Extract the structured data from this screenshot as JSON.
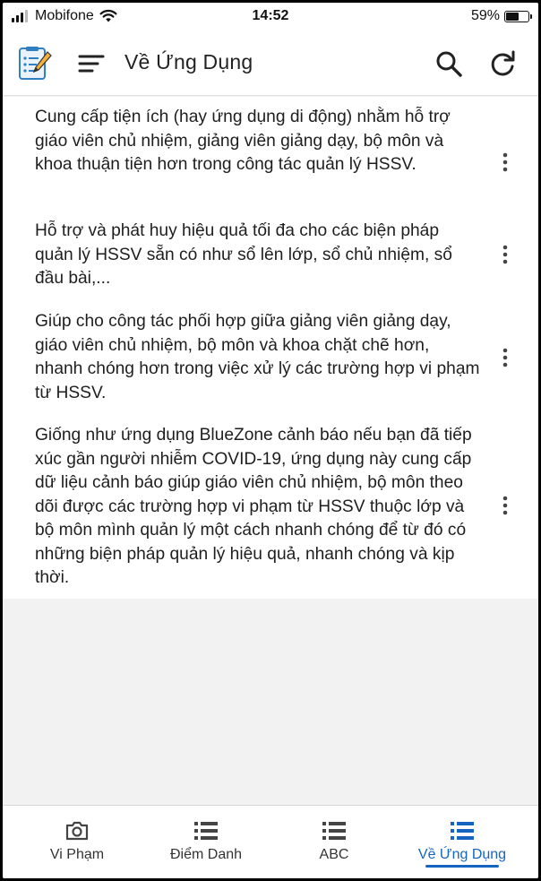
{
  "status_bar": {
    "carrier": "Mobifone",
    "time": "14:52",
    "battery": "59%",
    "battery_level": 0.59
  },
  "app_bar": {
    "title": "Về Ứng Dụng",
    "logo_icon": "checklist-pencil-icon",
    "menu_icon": "menu-icon",
    "search_icon": "search-icon",
    "refresh_icon": "refresh-icon"
  },
  "items": [
    {
      "text": "Cung cấp tiện ích (hay ứng dụng di động) nhằm hỗ trợ giáo viên chủ nhiệm, giảng viên giảng dạy, bộ môn và khoa thuận tiện hơn trong công tác quản lý HSSV."
    },
    {
      "text": "Hỗ trợ và phát huy hiệu quả tối đa cho các biện pháp quản lý HSSV sẵn có như sổ lên lớp, sổ chủ nhiệm, sổ đầu bài,..."
    },
    {
      "text": "Giúp cho công tác phối hợp giữa giảng viên giảng dạy, giáo viên chủ nhiệm, bộ môn và khoa chặt chẽ hơn, nhanh chóng hơn trong việc xử lý các trường hợp vi phạm từ HSSV."
    },
    {
      "text": "Giống như ứng dụng BlueZone cảnh báo nếu bạn đã tiếp xúc gần người nhiễm COVID-19, ứng dụng này cung cấp dữ liệu cảnh báo giúp giáo viên chủ nhiệm, bộ môn theo dõi được các trường hợp vi phạm từ HSSV thuộc lớp và bộ môn mình quản lý một cách nhanh chóng để từ đó có những biện pháp quản lý hiệu quả, nhanh chóng và kịp thời."
    }
  ],
  "bottom_nav": {
    "tabs": [
      {
        "label": "Vi Phạm",
        "icon": "camera-icon"
      },
      {
        "label": "Điểm Danh",
        "icon": "list-icon"
      },
      {
        "label": "ABC",
        "icon": "list-icon"
      },
      {
        "label": "Về Ứng Dụng",
        "icon": "list-icon"
      }
    ],
    "active_tab": "Về Ứng Dụng"
  },
  "colors": {
    "accent": "#1565c0",
    "background": "#f2f2f2",
    "surface": "#ffffff",
    "text": "#1e1e1e"
  }
}
